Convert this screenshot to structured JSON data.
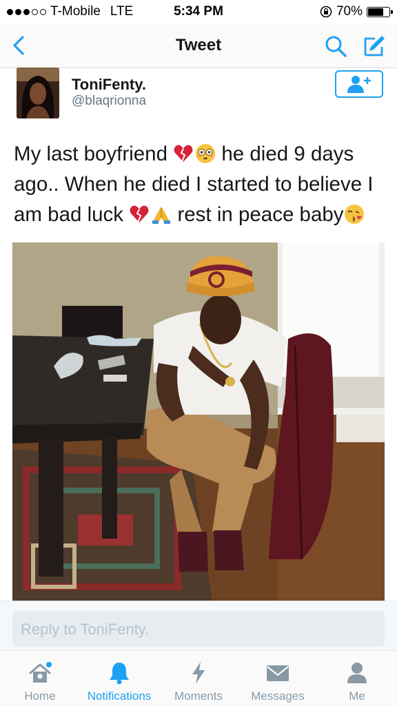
{
  "status_bar": {
    "carrier": "T-Mobile",
    "network": "LTE",
    "time": "5:34 PM",
    "battery": "70%",
    "battery_level": 0.7
  },
  "nav": {
    "title": "Tweet"
  },
  "tweet": {
    "display_name": "ToniFenty.",
    "handle": "@blaqrionna",
    "text_parts": [
      "My last boyfriend ",
      " he died 9 days ago.. When he died I started to believe I am bad luck ",
      " rest in peace baby"
    ],
    "emoji_icons": [
      "broken-heart-icon",
      "flushed-face-icon",
      "broken-heart-icon",
      "folded-hands-icon",
      "kissing-face-icon"
    ]
  },
  "reply": {
    "placeholder": "Reply to ToniFenty."
  },
  "tabs": [
    {
      "label": "Home",
      "icon": "home-icon",
      "active": false,
      "badge": true
    },
    {
      "label": "Notifications",
      "icon": "bell-icon",
      "active": true
    },
    {
      "label": "Moments",
      "icon": "lightning-icon",
      "active": false
    },
    {
      "label": "Messages",
      "icon": "envelope-icon",
      "active": false
    },
    {
      "label": "Me",
      "icon": "person-icon",
      "active": false
    }
  ],
  "colors": {
    "accent": "#1da1f2",
    "muted": "#8899a6"
  }
}
